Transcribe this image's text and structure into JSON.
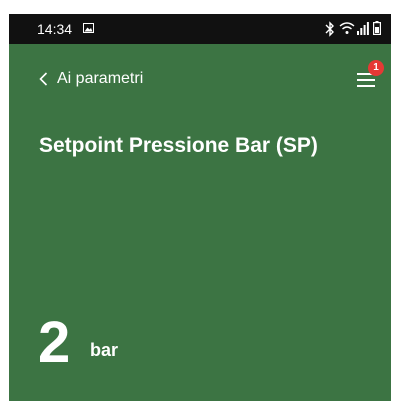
{
  "status_bar": {
    "time": "14:34",
    "icons": [
      "gallery-icon",
      "bluetooth-icon",
      "wifi-icon",
      "signal-icon",
      "battery-icon"
    ]
  },
  "header": {
    "back_label": "Ai parametri",
    "menu_badge_count": "1"
  },
  "parameter": {
    "title": "Setpoint Pressione Bar (SP)",
    "value": "2",
    "unit": "bar"
  },
  "colors": {
    "background": "#3c7443",
    "status_bar": "#111111",
    "badge": "#e53935",
    "text": "#ffffff"
  }
}
